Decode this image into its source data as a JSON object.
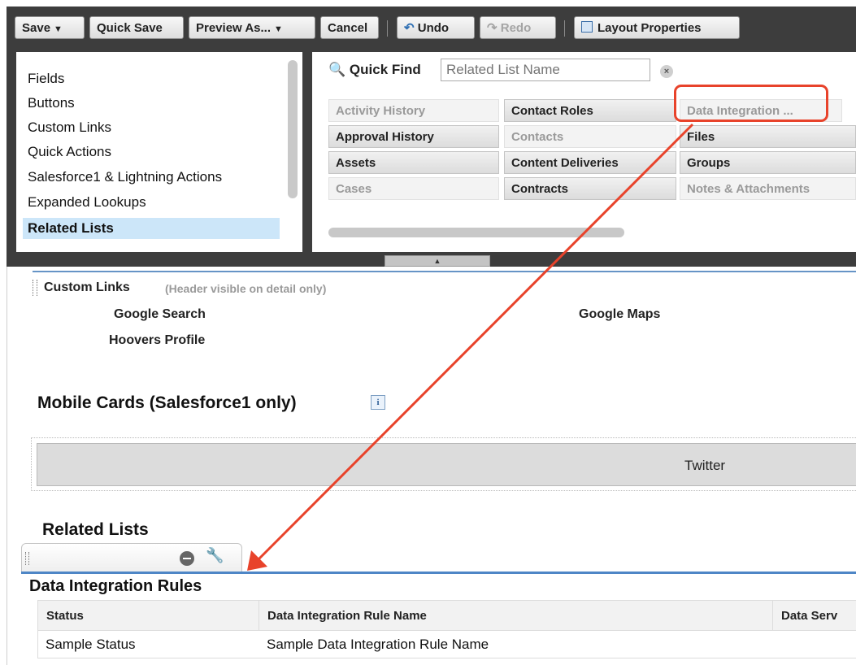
{
  "toolbar": {
    "save": "Save",
    "quick_save": "Quick Save",
    "preview_as": "Preview As...",
    "cancel": "Cancel",
    "undo": "Undo",
    "redo": "Redo",
    "layout_properties": "Layout Properties"
  },
  "palette": {
    "categories": [
      {
        "label": "Fields",
        "selected": false
      },
      {
        "label": "Buttons",
        "selected": false
      },
      {
        "label": "Custom Links",
        "selected": false
      },
      {
        "label": "Quick Actions",
        "selected": false
      },
      {
        "label": "Salesforce1 & Lightning Actions",
        "selected": false
      },
      {
        "label": "Expanded Lookups",
        "selected": false
      },
      {
        "label": "Related Lists",
        "selected": true
      }
    ],
    "quick_find": {
      "label": "Quick Find",
      "placeholder": "Related List Name",
      "clear_icon": "clear-icon"
    },
    "elements": [
      {
        "label": "Activity History",
        "state": "used"
      },
      {
        "label": "Contact Roles",
        "state": "available"
      },
      {
        "label": "Data Integration ...",
        "state": "used"
      },
      {
        "label": "Approval History",
        "state": "available"
      },
      {
        "label": "Contacts",
        "state": "used"
      },
      {
        "label": "Files",
        "state": "available"
      },
      {
        "label": "Assets",
        "state": "available"
      },
      {
        "label": "Content Deliveries",
        "state": "available"
      },
      {
        "label": "Groups",
        "state": "available"
      },
      {
        "label": "Cases",
        "state": "used"
      },
      {
        "label": "Contracts",
        "state": "available"
      },
      {
        "label": "Notes & Attachments",
        "state": "used"
      }
    ]
  },
  "custom_links": {
    "title": "Custom Links",
    "note": "(Header visible on detail only)",
    "links": [
      "Google Search",
      "Google Maps",
      "Hoovers Profile"
    ]
  },
  "mobile_cards": {
    "title": "Mobile Cards (Salesforce1 only)",
    "info_icon": "i",
    "cards": [
      "Twitter"
    ]
  },
  "related_lists": {
    "title": "Related Lists",
    "list_name": "Data Integration Rules",
    "columns": [
      "Status",
      "Data Integration Rule Name",
      "Data Serv"
    ],
    "row": [
      "Sample Status",
      "Sample Data Integration Rule Name",
      ""
    ]
  },
  "colors": {
    "highlight": "#e8432b",
    "section_line": "#4e86c6",
    "selected_category": "#cce6f9"
  }
}
